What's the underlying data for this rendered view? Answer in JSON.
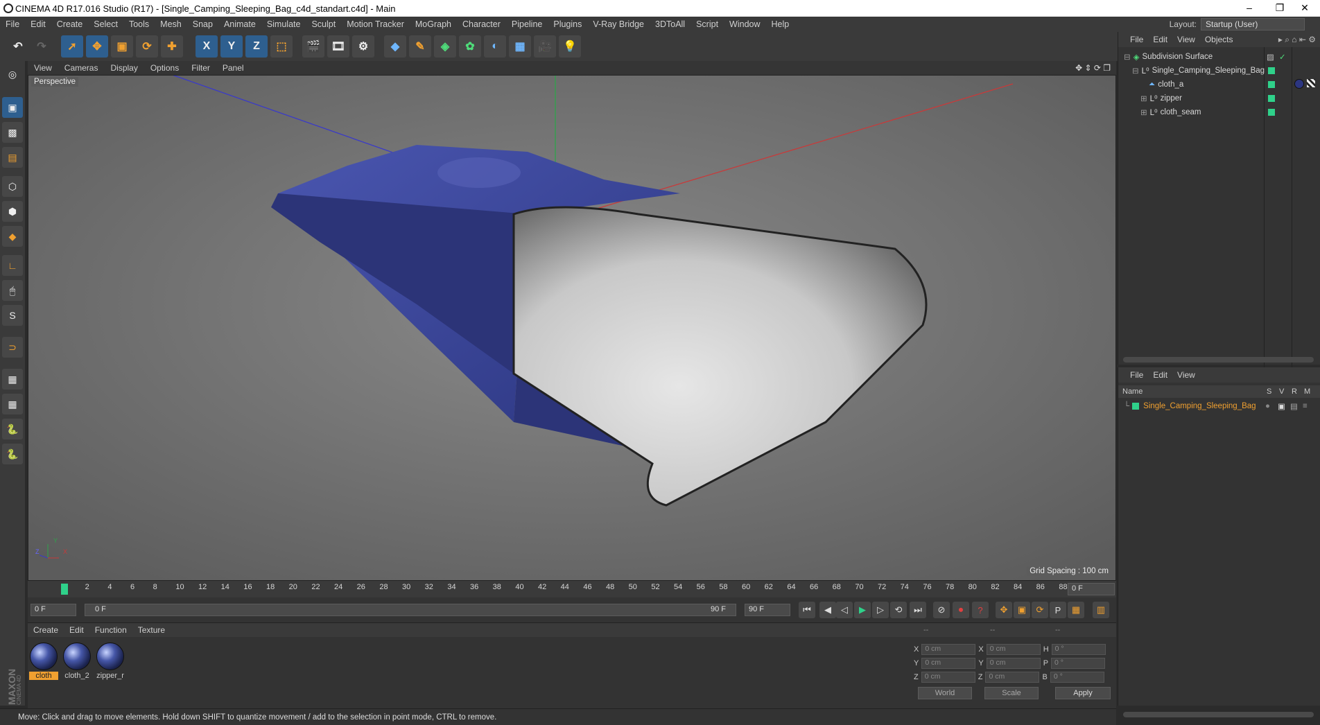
{
  "window": {
    "title": "CINEMA 4D R17.016 Studio (R17) - [Single_Camping_Sleeping_Bag_c4d_standart.c4d] - Main",
    "minimize": "–",
    "restore": "❐",
    "close": "✕"
  },
  "menu": [
    "File",
    "Edit",
    "Create",
    "Select",
    "Tools",
    "Mesh",
    "Snap",
    "Animate",
    "Simulate",
    "Sculpt",
    "Motion Tracker",
    "MoGraph",
    "Character",
    "Pipeline",
    "Plugins",
    "V-Ray Bridge",
    "3DToAll",
    "Script",
    "Window",
    "Help"
  ],
  "layout": {
    "label": "Layout:",
    "value": "Startup (User)"
  },
  "toolbar": {
    "x_label": "X",
    "y_label": "Y",
    "z_label": "Z"
  },
  "viewport": {
    "menu": [
      "View",
      "Cameras",
      "Display",
      "Options",
      "Filter",
      "Panel"
    ],
    "label": "Perspective",
    "grid_spacing": "Grid Spacing : 100 cm",
    "axis_x": "X",
    "axis_y": "Y",
    "axis_z": "Z"
  },
  "timeline": {
    "ticks": [
      "0",
      "2",
      "4",
      "6",
      "8",
      "10",
      "12",
      "14",
      "16",
      "18",
      "20",
      "22",
      "24",
      "26",
      "28",
      "30",
      "32",
      "34",
      "36",
      "38",
      "40",
      "42",
      "44",
      "46",
      "48",
      "50",
      "52",
      "54",
      "56",
      "58",
      "60",
      "62",
      "64",
      "66",
      "68",
      "70",
      "72",
      "74",
      "76",
      "78",
      "80",
      "82",
      "84",
      "86",
      "88",
      "90"
    ],
    "current_frame": "0 F",
    "start": "0 F",
    "range_start": "0 F",
    "range_end": "90 F",
    "end": "90 F",
    "current_frame_fraction": 0.0
  },
  "materials": {
    "menu": [
      "Create",
      "Edit",
      "Function",
      "Texture"
    ],
    "items": [
      {
        "name": "cloth",
        "selected": true
      },
      {
        "name": "cloth_2",
        "selected": false
      },
      {
        "name": "zipper_r",
        "selected": false
      }
    ]
  },
  "coords": {
    "header": [
      "--",
      "--",
      "--"
    ],
    "rows": [
      {
        "a": "X",
        "av": "0 cm",
        "b": "X",
        "bv": "0 cm",
        "c": "H",
        "cv": "0 °"
      },
      {
        "a": "Y",
        "av": "0 cm",
        "b": "Y",
        "bv": "0 cm",
        "c": "P",
        "cv": "0 °"
      },
      {
        "a": "Z",
        "av": "0 cm",
        "b": "Z",
        "bv": "0 cm",
        "c": "B",
        "cv": "0 °"
      }
    ],
    "world": "World",
    "scale": "Scale",
    "apply": "Apply"
  },
  "status": "Move: Click and drag to move elements. Hold down SHIFT to quantize movement / add to the selection in point mode, CTRL to remove.",
  "objects": {
    "menu": [
      "File",
      "Edit",
      "View",
      "Objects"
    ],
    "tree": [
      {
        "name": "Subdivision Surface",
        "indent": 0
      },
      {
        "name": "Single_Camping_Sleeping_Bag",
        "indent": 1
      },
      {
        "name": "cloth_a",
        "indent": 2
      },
      {
        "name": "zipper",
        "indent": 2
      },
      {
        "name": "cloth_seam",
        "indent": 2
      }
    ]
  },
  "attributes": {
    "menu": [
      "File",
      "Edit",
      "View"
    ],
    "columns": {
      "name": "Name",
      "s": "S",
      "v": "V",
      "r": "R",
      "m": "M"
    },
    "row": "Single_Camping_Sleeping_Bag"
  },
  "colors": {
    "accent": "#f0a030",
    "green_tag": "#2fd18a",
    "active_tool": "#2e5f8f"
  }
}
